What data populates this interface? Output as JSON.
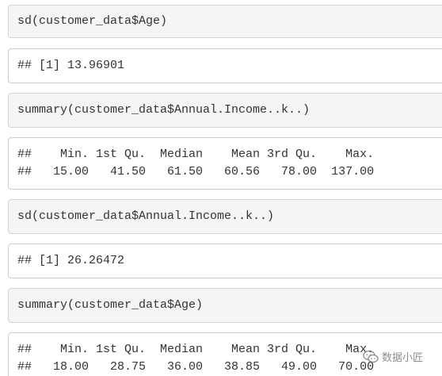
{
  "blocks": [
    {
      "type": "code",
      "text": "sd(customer_data$Age)"
    },
    {
      "type": "output",
      "lines": [
        "## [1] 13.96901"
      ]
    },
    {
      "type": "code",
      "text": "summary(customer_data$Annual.Income..k..)"
    },
    {
      "type": "output",
      "lines": [
        "##    Min. 1st Qu.  Median    Mean 3rd Qu.    Max. ",
        "##   15.00   41.50   61.50   60.56   78.00  137.00 "
      ]
    },
    {
      "type": "code",
      "text": "sd(customer_data$Annual.Income..k..)"
    },
    {
      "type": "output",
      "lines": [
        "## [1] 26.26472"
      ]
    },
    {
      "type": "code",
      "text": "summary(customer_data$Age)"
    },
    {
      "type": "output",
      "lines": [
        "##    Min. 1st Qu.  Median    Mean 3rd Qu.    Max. ",
        "##   18.00   28.75   36.00   38.85   49.00   70.00 "
      ]
    }
  ],
  "watermark": {
    "text": "数据小匠",
    "icon": "chat-bubble-icon"
  }
}
